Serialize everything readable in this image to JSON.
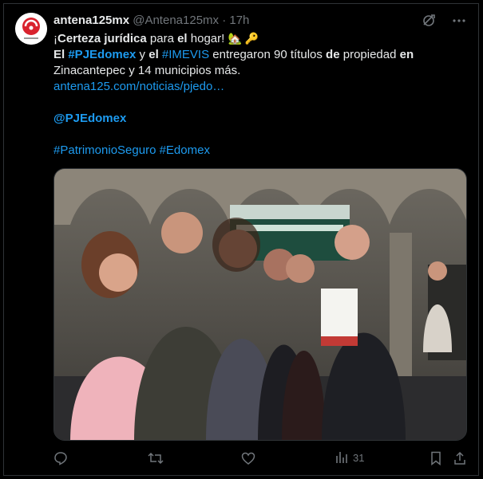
{
  "tweet": {
    "display_name": "antena125mx",
    "handle": "@Antena125mx",
    "separator": "·",
    "time": "17h",
    "line1": {
      "pre": "¡",
      "bold1": "Certeza jurídica",
      "mid1": " para ",
      "bold2": "el",
      "mid2": " hogar! ",
      "emoji": "🏡 🔑"
    },
    "line2": {
      "pre": "El ",
      "tag1": "#PJEdomex",
      "mid1": " y ",
      "b_el": "el",
      "sp": " ",
      "tag2": "#IMEVIS",
      "mid2": " entregaron 90 títulos ",
      "b_de": "de",
      "mid3": " propiedad ",
      "b_en": "en"
    },
    "line3": "Zinacantepec y 14 municipios más.",
    "link": "antena125.com/noticias/pjedo…",
    "mention": "@PJEdomex",
    "hashtags": "#PatrimonioSeguro #Edomex"
  },
  "actions": {
    "views": "31"
  },
  "icons": {
    "grok": "grok-icon",
    "more": "more-icon",
    "reply": "reply-icon",
    "retweet": "retweet-icon",
    "like": "heart-icon",
    "views": "views-icon",
    "bookmark": "bookmark-icon",
    "share": "share-icon"
  },
  "colors": {
    "link": "#1d9bf0",
    "muted": "#71767b",
    "text": "#e7e9ea",
    "background": "#000000"
  }
}
